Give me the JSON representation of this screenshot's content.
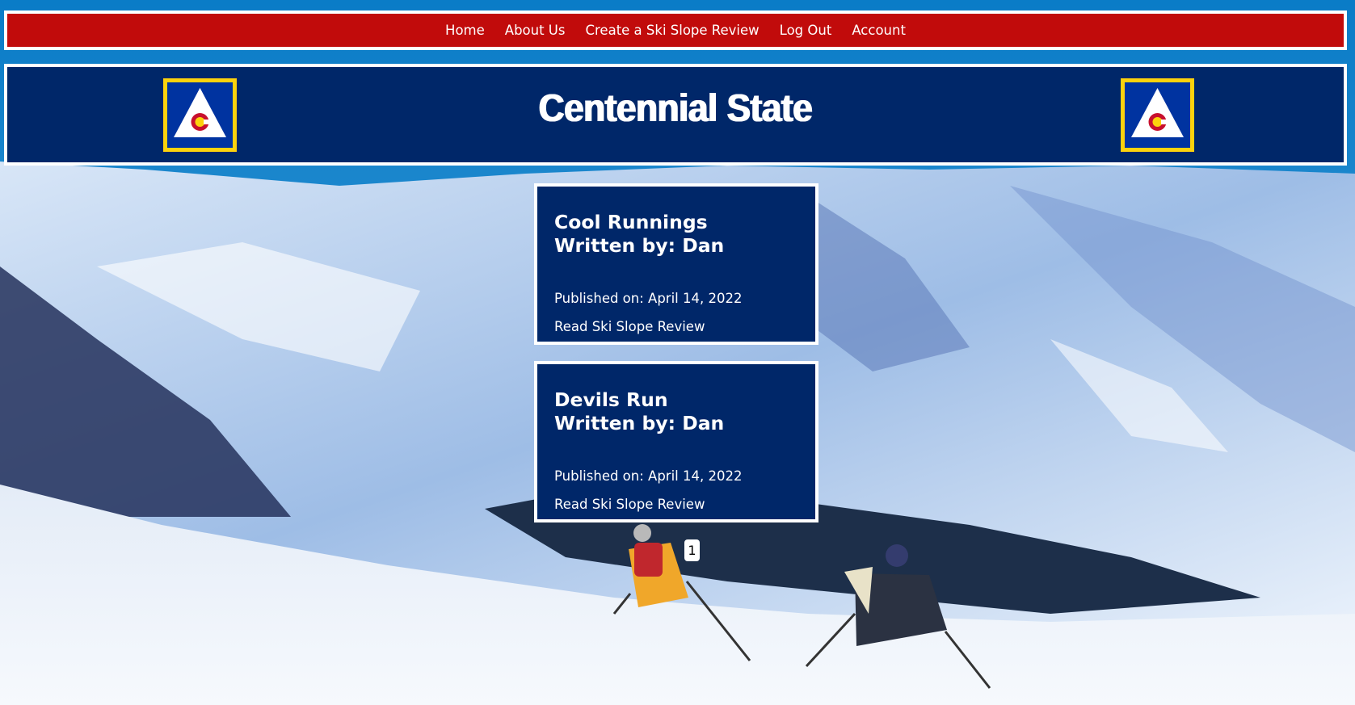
{
  "nav": {
    "items": [
      {
        "label": "Home"
      },
      {
        "label": "About Us"
      },
      {
        "label": "Create a Ski Slope Review"
      },
      {
        "label": "Log Out"
      },
      {
        "label": "Account"
      }
    ]
  },
  "header": {
    "title": "Centennial State",
    "logo_icon": "colorado-mountain-flag-icon"
  },
  "reviews": [
    {
      "title": "Cool Runnings",
      "author_line": "Written by: Dan",
      "published": "Published on: April 14, 2022",
      "link_label": "Read Ski Slope Review"
    },
    {
      "title": "Devils Run",
      "author_line": "Written by: Dan",
      "published": "Published on: April 14, 2022",
      "link_label": "Read Ski Slope Review"
    }
  ],
  "pagination": {
    "current_page": "1"
  },
  "colors": {
    "nav_bg": "#c10b0b",
    "banner_bg": "#002769",
    "card_bg": "#002769",
    "logo_border": "#fcd20d"
  }
}
